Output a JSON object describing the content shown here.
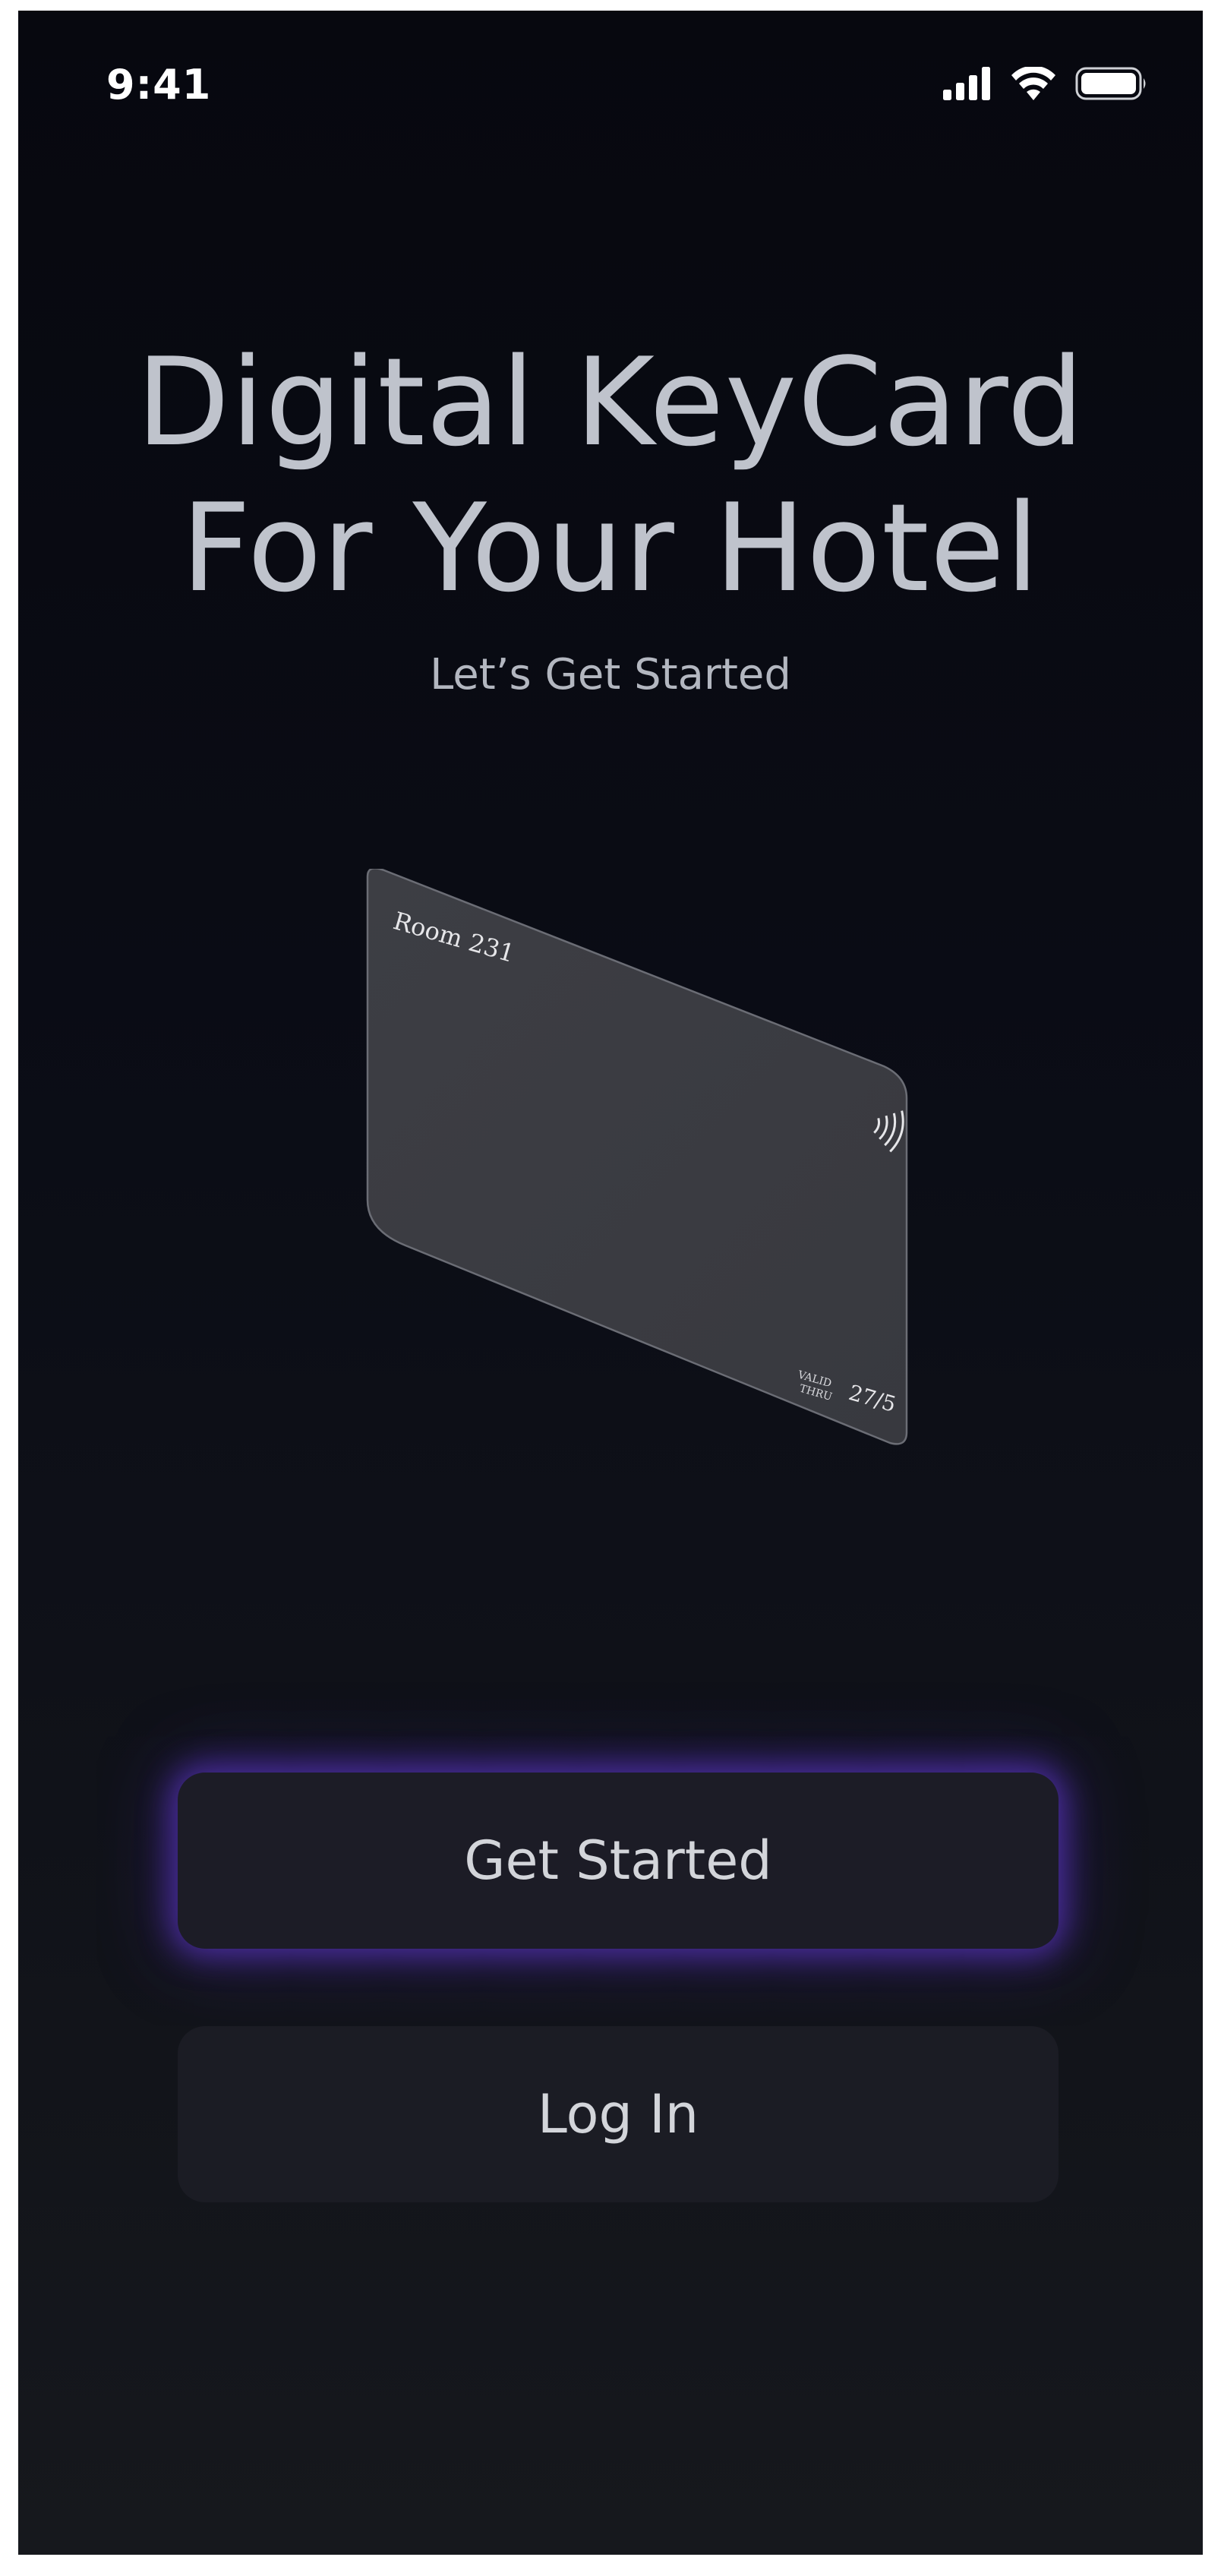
{
  "status_bar": {
    "time": "9:41",
    "icons": [
      "cellular-signal-icon",
      "wifi-icon",
      "battery-icon"
    ]
  },
  "hero": {
    "title_line_1": "Digital KeyCard",
    "title_line_2": "For Your Hotel",
    "subtitle": "Let’s Get Started"
  },
  "keycard": {
    "room_label": "Room 231",
    "valid_label_1": "VALID",
    "valid_label_2": "THRU",
    "valid_date": "27/5",
    "contactless_icon": "contactless-icon"
  },
  "actions": {
    "primary_label": "Get Started",
    "secondary_label": "Log In"
  },
  "colors": {
    "background_top": "#07080f",
    "background_bottom": "#16181d",
    "button_bg": "#1c1c26",
    "glow": "#5834be",
    "text": "#bfc3cc"
  }
}
